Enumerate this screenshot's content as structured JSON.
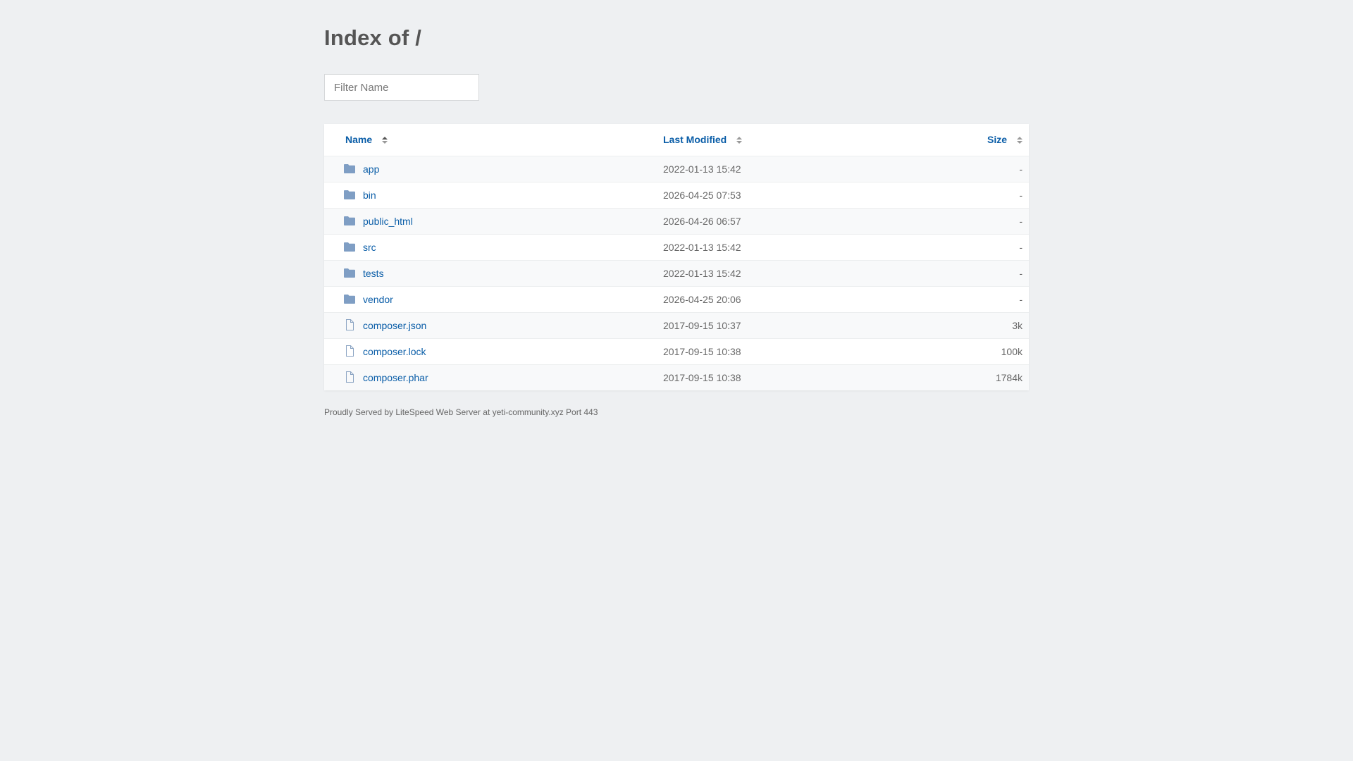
{
  "page": {
    "title": "Index of /",
    "filter_placeholder": "Filter Name",
    "footer": "Proudly Served by LiteSpeed Web Server at yeti-community.xyz Port 443"
  },
  "table": {
    "columns": [
      "Name",
      "Last Modified",
      "Size"
    ],
    "rows": [
      {
        "type": "folder-icon",
        "name": "app",
        "modified": "2022-01-13 15:42",
        "size": "-"
      },
      {
        "type": "folder-icon",
        "name": "bin",
        "modified": "2026-04-25 07:53",
        "size": "-"
      },
      {
        "type": "folder-icon",
        "name": "public_html",
        "modified": "2026-04-26 06:57",
        "size": "-"
      },
      {
        "type": "folder-icon",
        "name": "src",
        "modified": "2022-01-13 15:42",
        "size": "-"
      },
      {
        "type": "folder-icon",
        "name": "tests",
        "modified": "2022-01-13 15:42",
        "size": "-"
      },
      {
        "type": "folder-icon",
        "name": "vendor",
        "modified": "2026-04-25 20:06",
        "size": "-"
      },
      {
        "type": "file-icon",
        "name": "composer.json",
        "modified": "2017-09-15 10:37",
        "size": "3k"
      },
      {
        "type": "file-icon",
        "name": "composer.lock",
        "modified": "2017-09-15 10:38",
        "size": "100k"
      },
      {
        "type": "file-icon",
        "name": "composer.phar",
        "modified": "2017-09-15 10:38",
        "size": "1784k"
      }
    ]
  },
  "colors": {
    "background": "#eef0f2",
    "link": "#0b5ea8",
    "folder_icon": "#7f9ec4",
    "file_icon": "#8aa3c2"
  }
}
